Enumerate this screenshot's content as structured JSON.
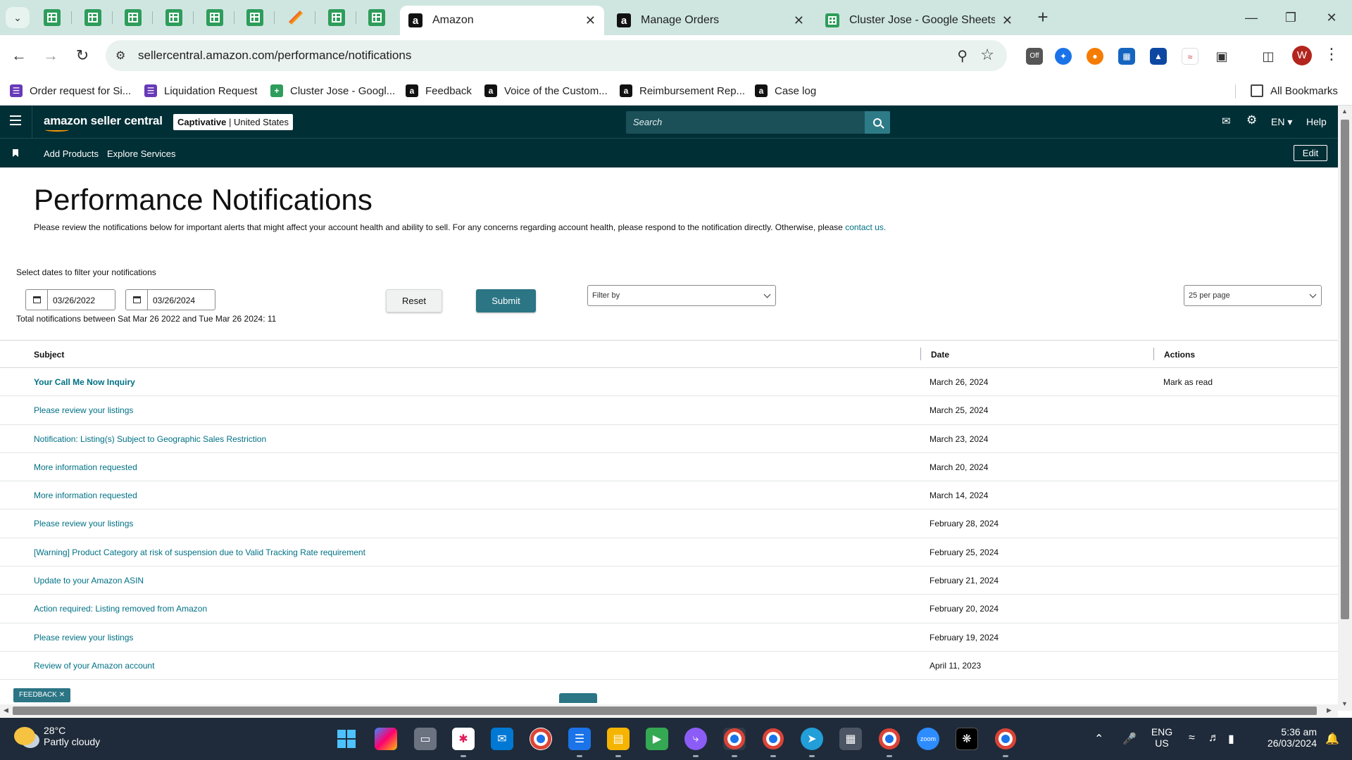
{
  "browser": {
    "tabs": [
      {
        "label": "Amazon",
        "favicon": "amazon-icon",
        "active": true
      },
      {
        "label": "Manage Orders",
        "favicon": "amazon-icon",
        "active": false
      },
      {
        "label": "Cluster Jose - Google Sheets",
        "favicon": "google-sheets-icon",
        "active": false
      }
    ],
    "url": "sellercentral.amazon.com/performance/notifications",
    "avatar_initial": "W",
    "extension_badge": "Off",
    "bookmarks": [
      {
        "label": "Order request for Si...",
        "icon": "google-forms-icon"
      },
      {
        "label": "Liquidation Request",
        "icon": "google-forms-icon"
      },
      {
        "label": "Cluster Jose - Googl...",
        "icon": "google-sheets-icon"
      },
      {
        "label": "Feedback",
        "icon": "amazon-icon"
      },
      {
        "label": "Voice of the Custom...",
        "icon": "amazon-icon"
      },
      {
        "label": "Reimbursement Rep...",
        "icon": "amazon-icon"
      },
      {
        "label": "Case log",
        "icon": "amazon-icon"
      }
    ],
    "all_bookmarks": "All Bookmarks"
  },
  "header": {
    "logo": "amazon seller central",
    "store_name": "Captivative",
    "store_region": "United States",
    "search_placeholder": "Search",
    "language": "EN",
    "help": "Help"
  },
  "subnav": {
    "links": [
      "Add Products",
      "Explore Services"
    ],
    "edit": "Edit"
  },
  "page": {
    "title": "Performance Notifications",
    "intro": "Please review the notifications below for important alerts that might affect your account health and ability to sell. For any concerns regarding account health, please respond to the notification directly. Otherwise, please",
    "contact_link": "contact us.",
    "filter_caption": "Select dates to filter your notifications",
    "date_from": "03/26/2022",
    "date_to": "03/26/2024",
    "reset": "Reset",
    "submit": "Submit",
    "filter_by": "Filter by",
    "per_page": "25 per page",
    "total": "Total notifications between Sat Mar 26 2022 and Tue Mar 26 2024: 11"
  },
  "table": {
    "headers": {
      "subject": "Subject",
      "date": "Date",
      "actions": "Actions"
    },
    "rows": [
      {
        "subject": "Your Call Me Now Inquiry",
        "date": "March 26, 2024",
        "action": "Mark as read",
        "unread": true
      },
      {
        "subject": "Please review your listings",
        "date": "March 25, 2024",
        "action": ""
      },
      {
        "subject": "Notification: Listing(s) Subject to Geographic Sales Restriction",
        "date": "March 23, 2024",
        "action": ""
      },
      {
        "subject": "More information requested",
        "date": "March 20, 2024",
        "action": ""
      },
      {
        "subject": "More information requested",
        "date": "March 14, 2024",
        "action": ""
      },
      {
        "subject": "Please review your listings",
        "date": "February 28, 2024",
        "action": ""
      },
      {
        "subject": "[Warning] Product Category at risk of suspension due to Valid Tracking Rate requirement",
        "date": "February 25, 2024",
        "action": ""
      },
      {
        "subject": "Update to your Amazon ASIN",
        "date": "February 21, 2024",
        "action": ""
      },
      {
        "subject": "Action required: Listing removed from Amazon",
        "date": "February 20, 2024",
        "action": ""
      },
      {
        "subject": "Please review your listings",
        "date": "February 19, 2024",
        "action": ""
      },
      {
        "subject": "Review of your Amazon account",
        "date": "April 11, 2023",
        "action": ""
      }
    ]
  },
  "feedback": "FEEDBACK",
  "taskbar": {
    "temperature": "28°C",
    "condition": "Partly cloudy",
    "language": "ENG",
    "region": "US",
    "time": "5:36 am",
    "date": "26/03/2024",
    "zoom_label": "zoom"
  },
  "colors": {
    "seller_central_header": "#002f36",
    "link": "#007185",
    "submit_button": "#2b7585",
    "tabstrip": "#cfe6e0",
    "taskbar": "#1f2b3a"
  }
}
